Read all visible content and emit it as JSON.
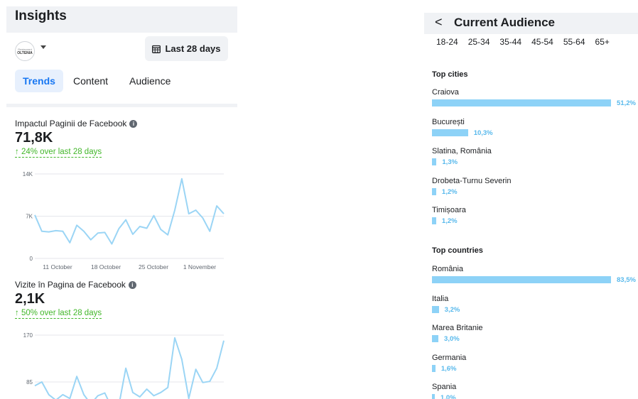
{
  "insights": {
    "title": "Insights",
    "logo": {
      "line1": "Restaurant",
      "line2": "OLTENIA"
    },
    "date_range": "Last 28 days",
    "tabs": [
      {
        "label": "Trends",
        "active": true
      },
      {
        "label": "Content",
        "active": false
      },
      {
        "label": "Audience",
        "active": false
      }
    ],
    "metrics": [
      {
        "label": "Impactul Paginii de Facebook",
        "value": "71,8K",
        "change": "↑ 24% over last 28 days",
        "chart_data": {
          "type": "line",
          "y_ticks": [
            "14K",
            "7K",
            "0"
          ],
          "ylim": [
            0,
            14000
          ],
          "x_ticks": [
            "11 October",
            "18 October",
            "25 October",
            "1 November"
          ],
          "values": [
            7200,
            4500,
            4400,
            4600,
            4500,
            2600,
            5500,
            4500,
            3100,
            4200,
            4300,
            2400,
            4900,
            6400,
            4000,
            5300,
            5000,
            7100,
            4800,
            3900,
            8000,
            13200,
            7400,
            8000,
            6700,
            4500,
            8700,
            7400
          ],
          "color": "#9bd5f5"
        }
      },
      {
        "label": "Vizite în Pagina de Facebook",
        "value": "2,1K",
        "change": "↑ 50% over last 28 days",
        "chart_data": {
          "type": "line",
          "y_ticks": [
            "170",
            "85"
          ],
          "ylim": [
            0,
            170
          ],
          "values": [
            78,
            85,
            62,
            52,
            62,
            55,
            95,
            62,
            45,
            60,
            65,
            38,
            42,
            110,
            66,
            58,
            72,
            60,
            66,
            75,
            165,
            126,
            55,
            108,
            84,
            86,
            110,
            160
          ],
          "color": "#9bd5f5"
        }
      }
    ]
  },
  "audience": {
    "title": "Current Audience",
    "back_icon": "chevron-left-icon",
    "age_groups": [
      "18-24",
      "25-34",
      "35-44",
      "45-54",
      "55-64",
      "65+"
    ],
    "top_cities": {
      "title": "Top cities",
      "items": [
        {
          "name": "Craiova",
          "percent": 51.2,
          "label": "51,2%"
        },
        {
          "name": "București",
          "percent": 10.3,
          "label": "10,3%"
        },
        {
          "name": "Slatina, România",
          "percent": 1.3,
          "label": "1,3%"
        },
        {
          "name": "Drobeta-Turnu Severin",
          "percent": 1.2,
          "label": "1,2%"
        },
        {
          "name": "Timișoara",
          "percent": 1.2,
          "label": "1,2%"
        }
      ]
    },
    "top_countries": {
      "title": "Top countries",
      "items": [
        {
          "name": "România",
          "percent": 83.5,
          "label": "83,5%"
        },
        {
          "name": "Italia",
          "percent": 3.2,
          "label": "3,2%"
        },
        {
          "name": "Marea Britanie",
          "percent": 3.0,
          "label": "3,0%"
        },
        {
          "name": "Germania",
          "percent": 1.6,
          "label": "1,6%"
        },
        {
          "name": "Spania",
          "percent": 1.0,
          "label": "1,0%"
        }
      ]
    },
    "bar_color": "#8dd2f7",
    "label_color": "#58b9ec"
  }
}
